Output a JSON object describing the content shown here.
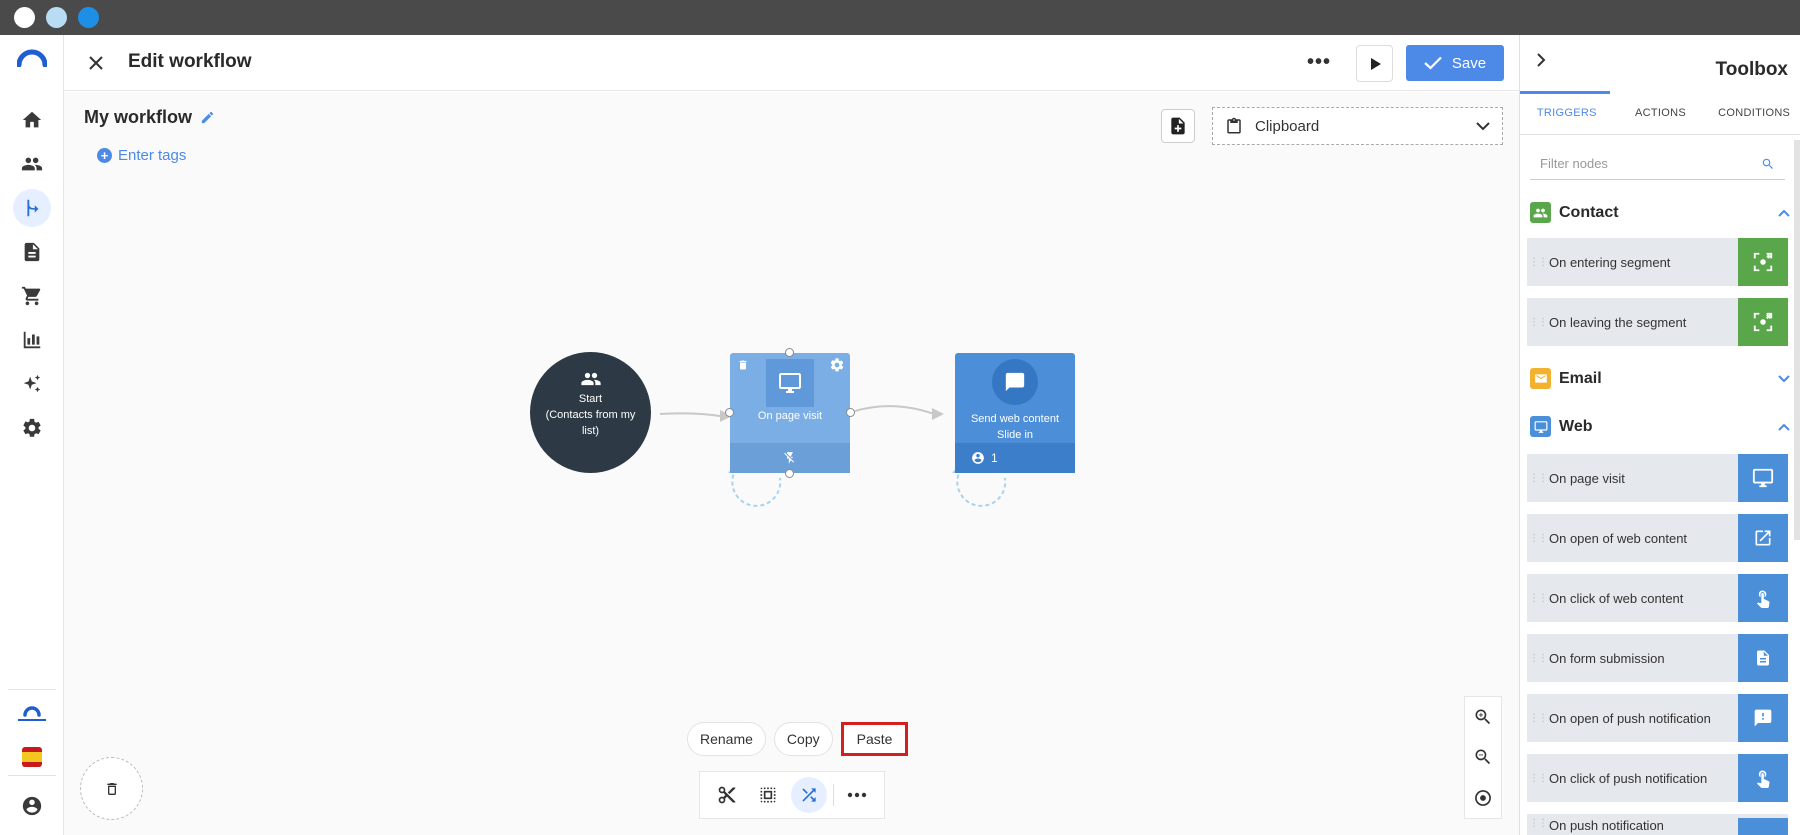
{
  "window": {
    "dots": [
      "#ffffff",
      "#b9dcf5",
      "#1e8fe6"
    ]
  },
  "header": {
    "title": "Edit workflow",
    "more": "•••",
    "save_label": "Save"
  },
  "canvas": {
    "workflow_name": "My workflow",
    "enter_tags": "Enter tags",
    "clipboard_label": "Clipboard",
    "nodes": {
      "start": {
        "line1": "Start",
        "line2": "(Contacts from my",
        "line3": "list)"
      },
      "trigger": {
        "label": "On page visit"
      },
      "action": {
        "line1": "Send web content",
        "line2": "Slide in",
        "count": "1"
      }
    },
    "context_menu": {
      "rename": "Rename",
      "copy": "Copy",
      "paste": "Paste"
    }
  },
  "toolbox": {
    "title": "Toolbox",
    "tabs": [
      "TRIGGERS",
      "ACTIONS",
      "CONDITIONS"
    ],
    "filter_placeholder": "Filter nodes",
    "sections": {
      "contact": {
        "label": "Contact",
        "color": "#5aa64b"
      },
      "email": {
        "label": "Email",
        "color": "#f2b230"
      },
      "web": {
        "label": "Web",
        "color": "#4a8fd8"
      }
    },
    "contact_items": [
      "On entering segment",
      "On leaving the segment"
    ],
    "web_items": [
      "On page visit",
      "On open of web content",
      "On click of web content",
      "On form submission",
      "On open of push notification",
      "On click of push notification",
      "On push notification"
    ]
  },
  "colors": {
    "accent": "#4d8ae8",
    "highlight": "#d21f1f",
    "start_node": "#2d3a45"
  }
}
